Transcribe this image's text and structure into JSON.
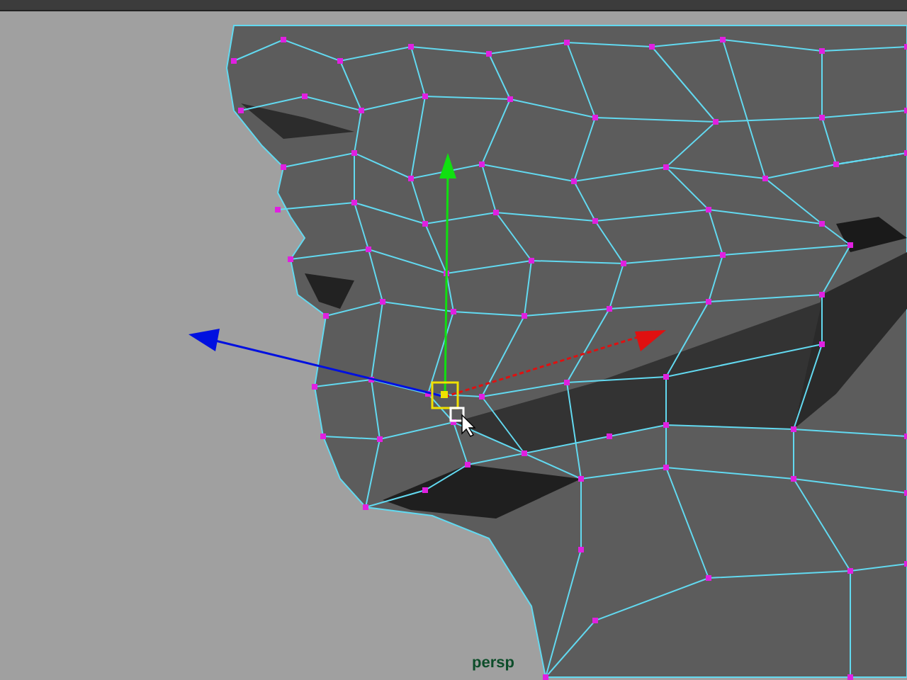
{
  "viewport": {
    "camera_label": "persp"
  }
}
